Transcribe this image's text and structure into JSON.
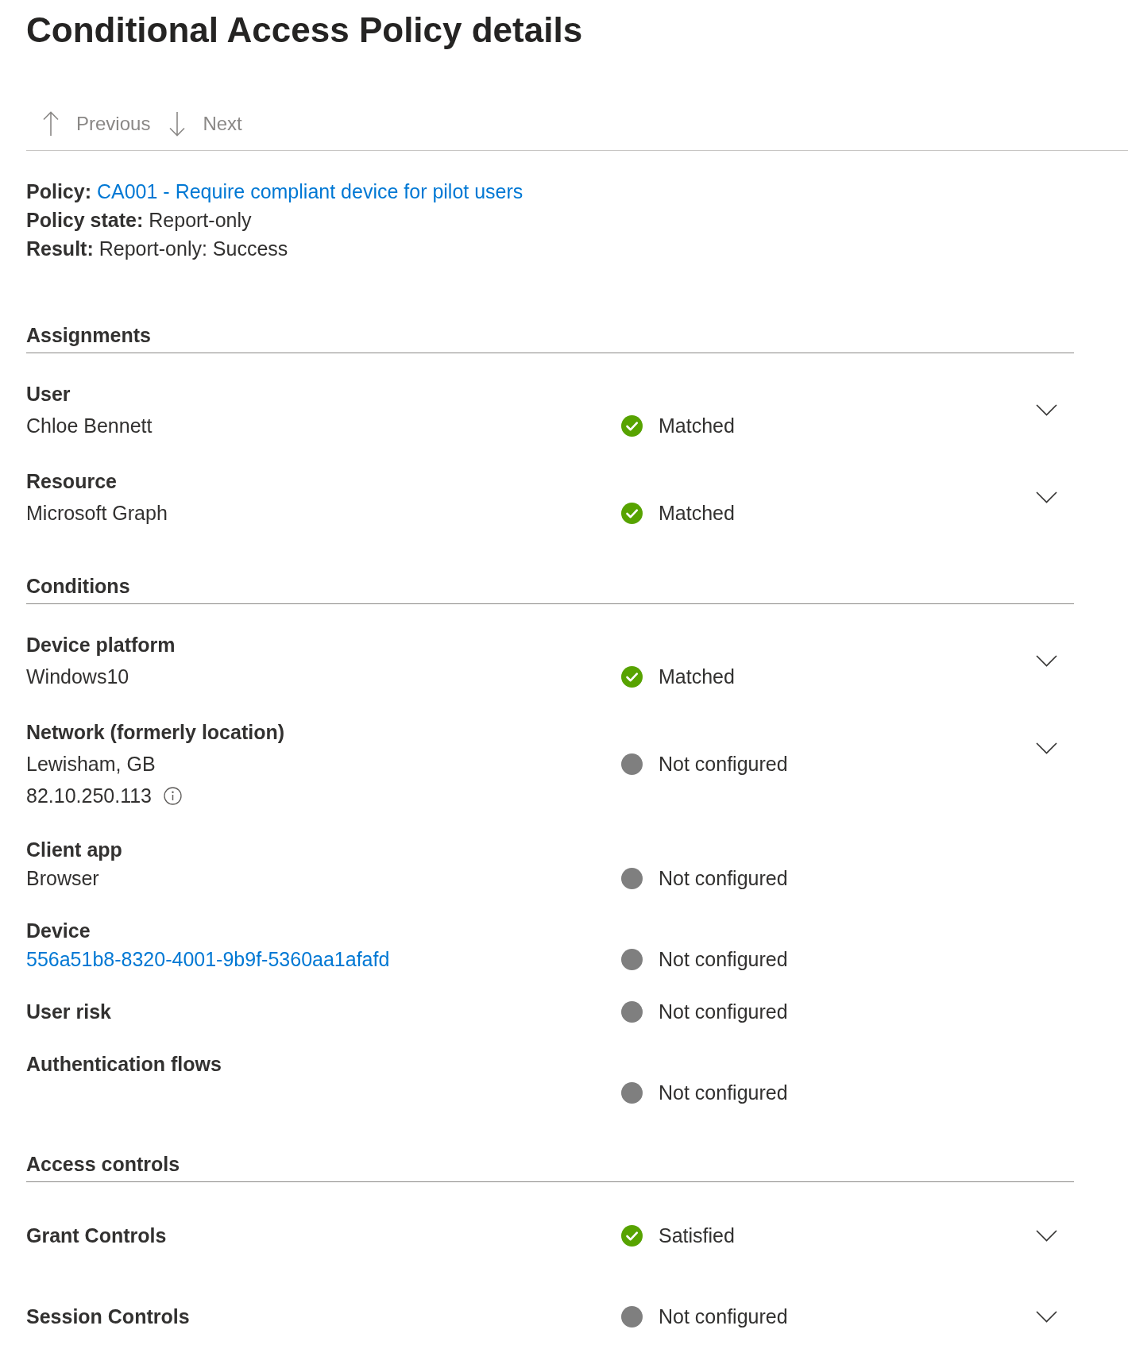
{
  "title": "Conditional Access Policy details",
  "toolbar": [
    {
      "label": "Previous",
      "kind": "up",
      "disabled": true
    },
    {
      "label": "Next",
      "kind": "down",
      "disabled": true
    }
  ],
  "summary": [
    {
      "label": "Policy:",
      "value": "CA001 - Require compliant device for pilot users",
      "kind": "link"
    },
    {
      "label": "Policy state:",
      "value": "Report-only",
      "kind": "text"
    },
    {
      "label": "Result:",
      "value": "Report-only: Success",
      "kind": "text"
    }
  ],
  "sections": [
    {
      "title": "Assignments",
      "items": [
        {
          "label": "User",
          "kind": "two_line",
          "values": [
            {
              "text": "Chloe Bennett",
              "kind": "text"
            }
          ],
          "status": {
            "text": "Matched",
            "kind": "success"
          },
          "expanded": false
        },
        {
          "label": "Resource",
          "kind": "two_line",
          "values": [
            {
              "text": "Microsoft Graph",
              "kind": "text"
            }
          ],
          "status": {
            "text": "Matched",
            "kind": "success"
          },
          "expanded": false
        }
      ]
    },
    {
      "title": "Conditions",
      "items": [
        {
          "label": "Device platform",
          "kind": "two_line",
          "values": [
            {
              "text": "Windows10",
              "kind": "text"
            }
          ],
          "status": {
            "text": "Matched",
            "kind": "success"
          },
          "expanded": false
        },
        {
          "label": "Network (formerly location)",
          "kind": "two_line",
          "values": [
            {
              "text": "Lewisham, GB",
              "kind": "text"
            },
            {
              "text": "82.10.250.113",
              "kind": "text",
              "info": true
            }
          ],
          "status": {
            "text": "Not configured",
            "kind": "neutral"
          },
          "expanded": false
        },
        {
          "label": "Client app",
          "kind": "two_line",
          "values": [
            {
              "text": "Browser",
              "kind": "text"
            }
          ],
          "status": {
            "text": "Not configured",
            "kind": "neutral"
          }
        },
        {
          "label": "Device",
          "kind": "two_line",
          "values": [
            {
              "text": "556a51b8-8320-4001-9b9f-5360aa1afafd",
              "kind": "link"
            }
          ],
          "status": {
            "text": "Not configured",
            "kind": "neutral"
          }
        },
        {
          "label": "User risk",
          "kind": "one_line",
          "status": {
            "text": "Not configured",
            "kind": "neutral"
          }
        },
        {
          "label": "Authentication flows",
          "kind": "two_line",
          "status": {
            "text": "Not configured",
            "kind": "neutral"
          }
        }
      ]
    },
    {
      "title": "Access controls",
      "items": [
        {
          "label": "Grant Controls",
          "kind": "one_line",
          "status": {
            "text": "Satisfied",
            "kind": "success"
          },
          "expanded": false
        },
        {
          "label": "Session Controls",
          "kind": "one_line",
          "status": {
            "text": "Not configured",
            "kind": "neutral"
          },
          "expanded": false
        }
      ]
    }
  ]
}
